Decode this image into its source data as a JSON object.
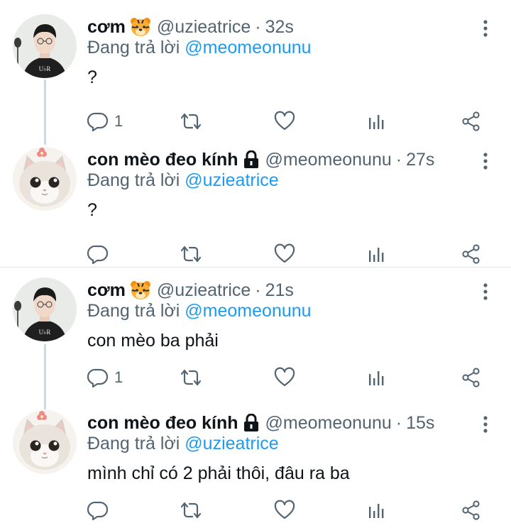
{
  "tweets": [
    {
      "name": "cơm",
      "emoji": "tiger-face-emoji",
      "handle": "@uzieatrice",
      "time": "32s",
      "reply_prefix": "Đang trả lời",
      "reply_to": "@meomeonunu",
      "text": "?",
      "reply_count": "1",
      "avatar": "avatar-boy"
    },
    {
      "name": "con mèo đeo kính",
      "emoji": "lock-icon",
      "handle": "@meomeonunu",
      "time": "27s",
      "reply_prefix": "Đang trả lời",
      "reply_to": "@uzieatrice",
      "text": "?",
      "reply_count": "",
      "avatar": "avatar-cat"
    },
    {
      "name": "cơm",
      "emoji": "tiger-face-emoji",
      "handle": "@uzieatrice",
      "time": "21s",
      "reply_prefix": "Đang trả lời",
      "reply_to": "@meomeonunu",
      "text": "con mèo ba phải",
      "reply_count": "1",
      "avatar": "avatar-boy"
    },
    {
      "name": "con mèo đeo kính",
      "emoji": "lock-icon",
      "handle": "@meomeonunu",
      "time": "15s",
      "reply_prefix": "Đang trả lời",
      "reply_to": "@uzieatrice",
      "text": "mình chỉ có 2 phải thôi, đâu ra ba",
      "reply_count": "",
      "avatar": "avatar-cat"
    }
  ],
  "separator": "·",
  "colors": {
    "text": "#0f1419",
    "secondary": "#536471",
    "link": "#1d9bf0",
    "line": "#cfd9de"
  }
}
